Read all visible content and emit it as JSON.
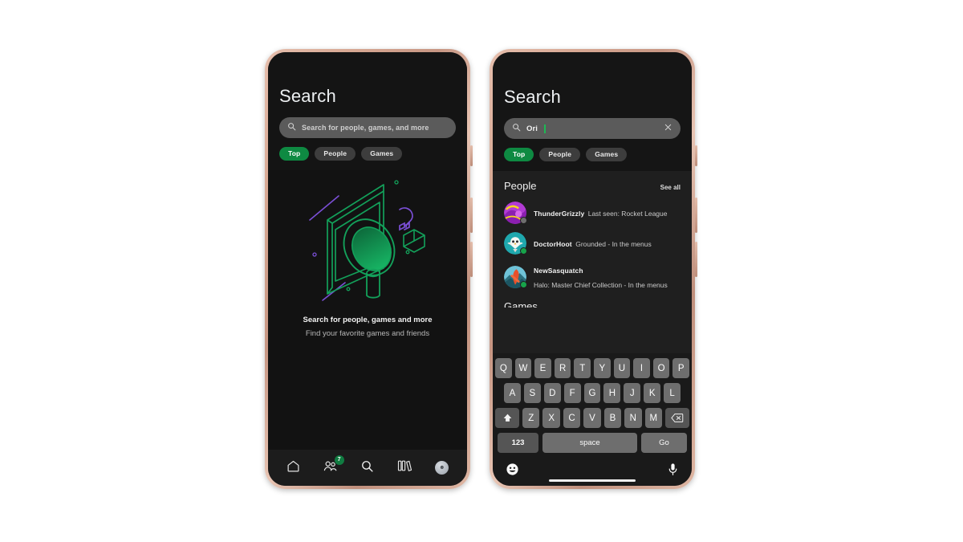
{
  "colors": {
    "accent_green": "#0e8a42",
    "frame_rose_gold": "#d8a994",
    "screen_bg": "#121212",
    "results_bg": "#1f1f1f",
    "key_gray": "#6e6e6e",
    "online_green": "#17a34a",
    "offline_gray": "#6e6e6e",
    "illustration_green": "#13a05a",
    "illustration_purple": "#8b5cf6"
  },
  "phone_empty": {
    "title": "Search",
    "search": {
      "placeholder": "Search for people, games, and more",
      "value": "",
      "icon": "search-icon"
    },
    "chips": [
      {
        "label": "Top",
        "active": true
      },
      {
        "label": "People",
        "active": false
      },
      {
        "label": "Games",
        "active": false
      }
    ],
    "empty_state": {
      "illustration": "isometric-search-illustration",
      "title": "Search for people, games and more",
      "subtitle": "Find your favorite games and friends"
    },
    "bottom_nav": [
      {
        "name": "home",
        "icon": "home-icon",
        "badge": ""
      },
      {
        "name": "people",
        "icon": "people-icon",
        "badge": "7"
      },
      {
        "name": "search",
        "icon": "search-icon",
        "badge": ""
      },
      {
        "name": "library",
        "icon": "library-icon",
        "badge": ""
      },
      {
        "name": "profile",
        "icon": "avatar-icon",
        "badge": ""
      }
    ]
  },
  "phone_results": {
    "title": "Search",
    "search": {
      "placeholder": "Search for people, games, and more",
      "value": "Ori",
      "icon": "search-icon",
      "clear_icon": "close-icon"
    },
    "chips": [
      {
        "label": "Top",
        "active": true
      },
      {
        "label": "People",
        "active": false
      },
      {
        "label": "Games",
        "active": false
      }
    ],
    "sections": {
      "people": {
        "title": "People",
        "see_all": "See all",
        "items": [
          {
            "name": "ThunderGrizzly",
            "status": "Last seen: Rocket League",
            "presence": "offline",
            "avatar": "purple-yellow-abstract"
          },
          {
            "name": "DoctorHoot",
            "status": "Grounded - In the menus",
            "presence": "online",
            "avatar": "teal-owl"
          },
          {
            "name": "NewSasquatch",
            "status": "Halo: Master Chief Collection - In the menus",
            "presence": "online",
            "avatar": "blue-sasquatch"
          }
        ]
      },
      "games": {
        "title": "Games"
      }
    },
    "keyboard": {
      "row1": [
        "Q",
        "W",
        "E",
        "R",
        "T",
        "Y",
        "U",
        "I",
        "O",
        "P"
      ],
      "row2": [
        "A",
        "S",
        "D",
        "F",
        "G",
        "H",
        "J",
        "K",
        "L"
      ],
      "row3": [
        "Z",
        "X",
        "C",
        "V",
        "B",
        "N",
        "M"
      ],
      "shift_key": "shift-icon",
      "backspace_key": "backspace-icon",
      "num_key": "123",
      "space_key": "space",
      "action_key": "Go",
      "emoji_key": "emoji-icon",
      "mic_key": "microphone-icon"
    }
  }
}
